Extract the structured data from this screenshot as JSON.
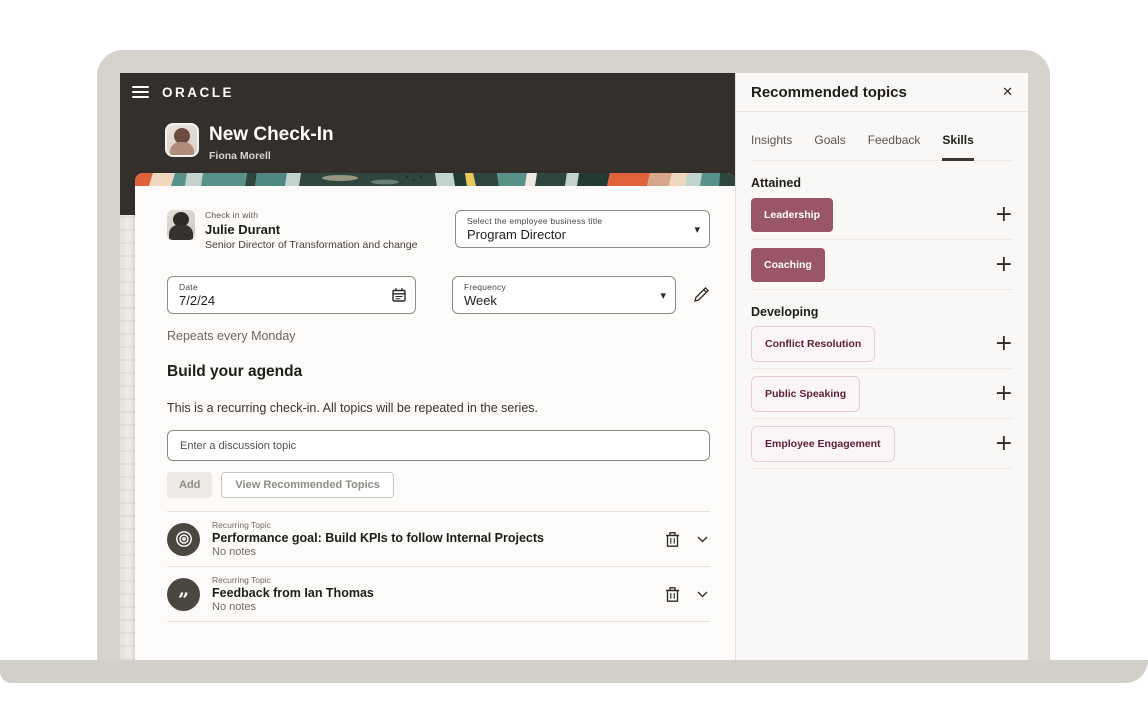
{
  "colors": {
    "accent_maroon": "#9A5568",
    "chip_outline_border": "#E9CBD3",
    "chip_outline_text": "#5C2135",
    "header_dark": "#332F2B",
    "frame_gray": "#D6D2CC"
  },
  "window": {
    "brand": "ORACLE",
    "title": "New Check-In",
    "subtitle": "Fiona Morell"
  },
  "checkin": {
    "with_label": "Check in with",
    "with_name": "Julie Durant",
    "with_title": "Senior Director of Transformation and change",
    "business_title_label": "Select the employee business title",
    "business_title_value": "Program Director",
    "date_label": "Date",
    "date_value": "7/2/24",
    "frequency_label": "Frequency",
    "frequency_value": "Week",
    "repeats_text": "Repeats every Monday"
  },
  "agenda": {
    "heading": "Build your agenda",
    "description": "This is a recurring check-in. All topics will be repeated in the series.",
    "topic_placeholder": "Enter a discussion topic",
    "add_label": "Add",
    "view_recommended_label": "View Recommended Topics",
    "topics": [
      {
        "type_label": "Recurring Topic",
        "title": "Performance goal: Build KPIs to follow Internal Projects",
        "notes": "No notes",
        "icon": "target-icon"
      },
      {
        "type_label": "Recurring Topic",
        "title": "Feedback from Ian Thomas",
        "notes": "No notes",
        "icon": "quote-icon"
      }
    ]
  },
  "panel": {
    "title": "Recommended topics",
    "active_tab": "Skills",
    "tabs": [
      {
        "label": "Insights"
      },
      {
        "label": "Goals"
      },
      {
        "label": "Feedback"
      },
      {
        "label": "Skills"
      }
    ],
    "sections": [
      {
        "heading": "Attained",
        "chips": [
          {
            "label": "Leadership",
            "style": "filled"
          },
          {
            "label": "Coaching",
            "style": "filled"
          }
        ]
      },
      {
        "heading": "Developing",
        "chips": [
          {
            "label": "Conflict Resolution",
            "style": "outlined"
          },
          {
            "label": "Public Speaking",
            "style": "outlined"
          },
          {
            "label": "Employee Engagement",
            "style": "outlined"
          }
        ]
      }
    ]
  },
  "icons": {
    "close": "✕",
    "plus": "+",
    "select_chevron": "▾",
    "quote": "”"
  }
}
